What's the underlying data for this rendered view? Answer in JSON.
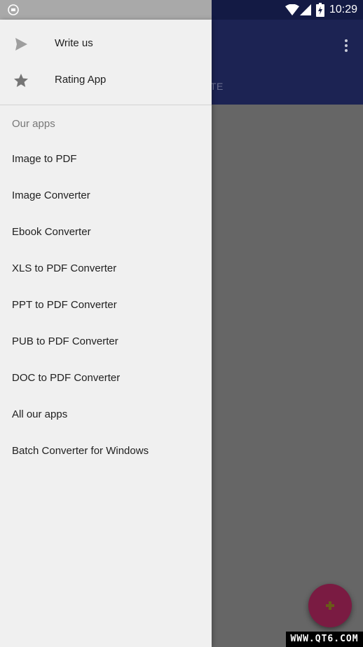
{
  "status_bar": {
    "time": "10:29",
    "icons": [
      "app-notification-icon",
      "wifi-icon",
      "signal-icon",
      "battery-charging-icon"
    ]
  },
  "background_app": {
    "tab_fragment": "TE",
    "toolbar_color": "#1c2353",
    "fab_color": "#7a1b42"
  },
  "drawer": {
    "actions": [
      {
        "label": "Write us",
        "icon": "send-icon"
      },
      {
        "label": "Rating App",
        "icon": "star-icon"
      }
    ],
    "section_header": "Our apps",
    "apps": [
      {
        "label": "Image to PDF"
      },
      {
        "label": "Image Converter"
      },
      {
        "label": "Ebook Converter"
      },
      {
        "label": "XLS to PDF Converter"
      },
      {
        "label": "PPT to PDF Converter"
      },
      {
        "label": "PUB to PDF Converter"
      },
      {
        "label": "DOC to PDF Converter"
      },
      {
        "label": "All our apps"
      },
      {
        "label": "Batch Converter for Windows"
      }
    ]
  },
  "watermark": "WWW.QT6.COM"
}
